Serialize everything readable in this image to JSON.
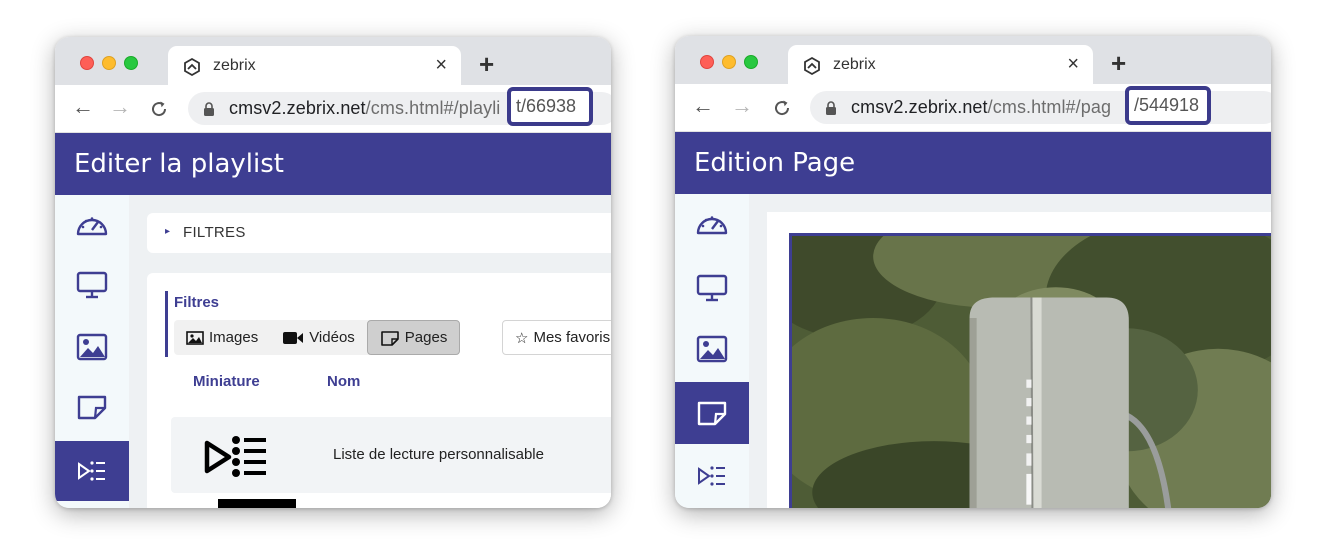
{
  "colors": {
    "brand": "#3e3e92",
    "highlight_border": "#3b3a8b"
  },
  "left_window": {
    "tab": {
      "icon": "zebrix-logo-icon",
      "title": "zebrix",
      "close": "×"
    },
    "newtab": "+",
    "nav": {
      "back": "←",
      "forward": "→",
      "reload": "C"
    },
    "url": {
      "host": "cmsv2.zebrix.net",
      "path": "/cms.html#/playli",
      "id": "t/66938"
    },
    "header_title": "Editer la playlist",
    "sidebar": [
      "dashboard-gauge-icon",
      "screen-monitor-icon",
      "image-icon",
      "page-icon",
      "playlist-icon"
    ],
    "active_sidebar": "playlist-icon",
    "filters_bar": {
      "caret": "▸",
      "label": "FILTRES"
    },
    "filter_group": {
      "title": "Filtres",
      "buttons": [
        {
          "label": "Images",
          "icon": "image-icon",
          "active": false
        },
        {
          "label": "Vidéos",
          "icon": "video-camera-icon",
          "active": false
        },
        {
          "label": "Pages",
          "icon": "page-icon",
          "active": true
        }
      ],
      "favorites": {
        "label": "Mes favoris",
        "icon": "star-icon"
      }
    },
    "columns": {
      "thumbnail": "Miniature",
      "name": "Nom"
    },
    "row": {
      "icon": "playlist-icon",
      "name": "Liste de lecture personnalisable"
    }
  },
  "right_window": {
    "tab": {
      "icon": "zebrix-logo-icon",
      "title": "zebrix",
      "close": "×"
    },
    "newtab": "+",
    "nav": {
      "back": "←",
      "forward": "→",
      "reload": "C"
    },
    "url": {
      "host": "cmsv2.zebrix.net",
      "path": "/cms.html#/pag",
      "id": "/544918"
    },
    "header_title": "Edition Page",
    "sidebar": [
      "dashboard-gauge-icon",
      "screen-monitor-icon",
      "image-icon",
      "page-icon",
      "playlist-icon"
    ],
    "active_sidebar": "page-icon",
    "preview": "kiosk-photo"
  }
}
